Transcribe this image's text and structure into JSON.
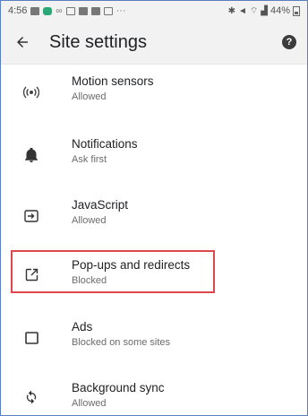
{
  "status_bar": {
    "time": "4:56",
    "icons": [
      "gallery-icon",
      "messenger-icon",
      "voicemail-icon",
      "calendar-icon",
      "mail-icon",
      "calendar-icon",
      "image-icon",
      "more-dots-icon"
    ],
    "battery": "44%"
  },
  "app_bar": {
    "title": "Site settings",
    "back_icon": "back-arrow-icon",
    "help_icon": "help-icon",
    "help_glyph": "?"
  },
  "items": [
    {
      "icon": "sensors-icon",
      "title": "Motion sensors",
      "subtitle": "Allowed"
    },
    {
      "icon": "bell-icon",
      "title": "Notifications",
      "subtitle": "Ask first"
    },
    {
      "icon": "javascript-icon",
      "title": "JavaScript",
      "subtitle": "Allowed"
    },
    {
      "icon": "open-in-new-icon",
      "title": "Pop-ups and redirects",
      "subtitle": "Blocked",
      "highlighted": true
    },
    {
      "icon": "ads-icon",
      "title": "Ads",
      "subtitle": "Blocked on some sites"
    },
    {
      "icon": "sync-icon",
      "title": "Background sync",
      "subtitle": "Allowed"
    }
  ],
  "colors": {
    "highlight_border": "#e0474c",
    "frame_border": "#5b7fbf"
  }
}
